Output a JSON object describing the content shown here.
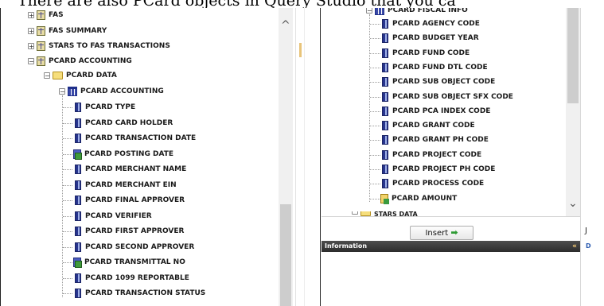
{
  "caption": "There are also PCard objects in Query Studio that you ca",
  "left_tree": {
    "top_items": [
      {
        "label": "FAS",
        "toggle": "+"
      },
      {
        "label": "FAS SUMMARY",
        "toggle": "+"
      },
      {
        "label": "STARS TO FAS TRANSACTIONS",
        "toggle": "+"
      },
      {
        "label": "PCARD ACCOUNTING",
        "toggle": "−"
      }
    ],
    "folder": {
      "label": "PCARD DATA",
      "toggle": "−"
    },
    "group": {
      "label": "PCARD ACCOUNTING",
      "toggle": "−"
    },
    "fields": [
      {
        "label": "PCARD TYPE",
        "icon": "dimension-icon"
      },
      {
        "label": "PCARD CARD HOLDER",
        "icon": "dimension-icon"
      },
      {
        "label": "PCARD TRANSACTION DATE",
        "icon": "dimension-icon"
      },
      {
        "label": "PCARD POSTING DATE",
        "icon": "date-icon"
      },
      {
        "label": "PCARD MERCHANT NAME",
        "icon": "dimension-icon"
      },
      {
        "label": "PCARD MERCHANT EIN",
        "icon": "dimension-icon"
      },
      {
        "label": "PCARD FINAL APPROVER",
        "icon": "dimension-icon"
      },
      {
        "label": "PCARD VERIFIER",
        "icon": "dimension-icon"
      },
      {
        "label": "PCARD FIRST APPROVER",
        "icon": "dimension-icon"
      },
      {
        "label": "PCARD SECOND APPROVER",
        "icon": "dimension-icon"
      },
      {
        "label": "PCARD TRANSMITTAL NO",
        "icon": "date-icon"
      },
      {
        "label": "PCARD 1099 REPORTABLE",
        "icon": "dimension-icon"
      },
      {
        "label": "PCARD TRANSACTION STATUS",
        "icon": "dimension-icon"
      }
    ]
  },
  "right_tree": {
    "group": {
      "label": "PCARD FISCAL INFO",
      "toggle": "−"
    },
    "fields": [
      {
        "label": "PCARD AGENCY CODE",
        "icon": "dimension-icon"
      },
      {
        "label": "PCARD BUDGET YEAR",
        "icon": "dimension-icon"
      },
      {
        "label": "PCARD FUND CODE",
        "icon": "dimension-icon"
      },
      {
        "label": "PCARD FUND DTL CODE",
        "icon": "dimension-icon"
      },
      {
        "label": "PCARD SUB OBJECT CODE",
        "icon": "dimension-icon"
      },
      {
        "label": "PCARD SUB OBJECT SFX CODE",
        "icon": "dimension-icon"
      },
      {
        "label": "PCARD PCA INDEX CODE",
        "icon": "dimension-icon"
      },
      {
        "label": "PCARD GRANT CODE",
        "icon": "dimension-icon"
      },
      {
        "label": "PCARD GRANT PH CODE",
        "icon": "dimension-icon"
      },
      {
        "label": "PCARD PROJECT CODE",
        "icon": "dimension-icon"
      },
      {
        "label": "PCARD PROJECT PH CODE",
        "icon": "dimension-icon"
      },
      {
        "label": "PCARD PROCESS CODE",
        "icon": "dimension-icon"
      },
      {
        "label": "PCARD AMOUNT",
        "icon": "measure-icon"
      }
    ],
    "next_item": "STARS DATA"
  },
  "insert_button": {
    "label": "Insert",
    "icon": "green-arrow-icon"
  },
  "info_bar": {
    "label": "Information",
    "icon": "collapse-icon"
  },
  "side_letters": [
    "J",
    "D"
  ]
}
